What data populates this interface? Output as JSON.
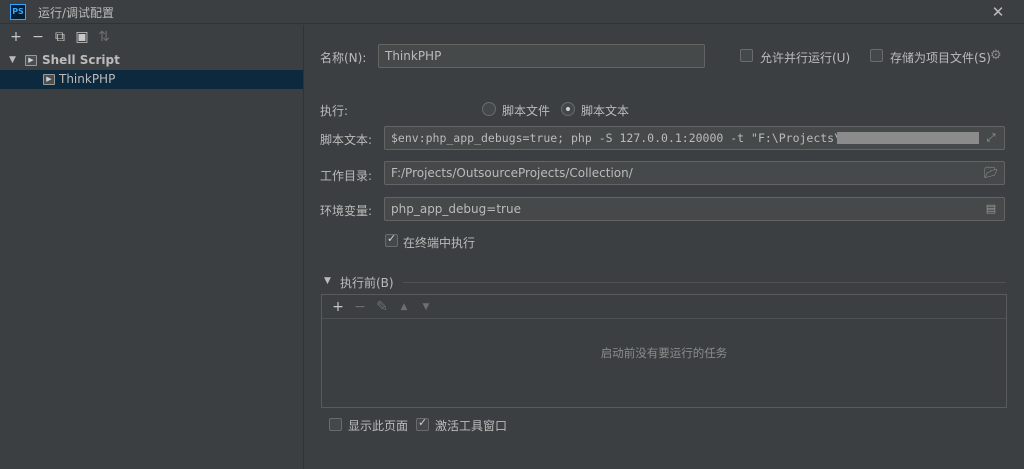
{
  "window": {
    "logo_text": "PS",
    "title": "运行/调试配置",
    "close_icon": "close-icon"
  },
  "left_toolbar": {
    "add": "+",
    "remove": "−",
    "copy": "⧉",
    "folder": "▣",
    "sort": "⇅"
  },
  "tree": {
    "group_label": "Shell Script",
    "group_icon_text": "▶",
    "item_label": "ThinkPHP",
    "item_icon_text": "▶"
  },
  "form": {
    "name_label": "名称(N):",
    "name_value": "ThinkPHP",
    "allow_parallel_label": "允许并行运行(U)",
    "allow_parallel_checked": false,
    "store_as_project_label": "存储为项目文件(S)",
    "store_as_project_checked": false,
    "execute_label": "执行:",
    "script_file_label": "脚本文件",
    "script_text_label": "脚本文本",
    "selected_mode": "script_text",
    "script_text_field_label": "脚本文本:",
    "script_text_value": "$env:php_app_debugs=true; php -S 127.0.0.1:20000 -t \"F:\\Projects\\",
    "workdir_label": "工作目录:",
    "workdir_value": "F:/Projects/OutsourceProjects/Collection/",
    "env_label": "环境变量:",
    "env_value": "php_app_debug=true",
    "run_in_terminal_label": "在终端中执行",
    "run_in_terminal_checked": true
  },
  "before_launch": {
    "section_label": "执行前(B)",
    "toolbar": {
      "add": "+",
      "remove": "−",
      "edit": "✎",
      "up": "▲",
      "down": "▼"
    },
    "empty_text": "启动前没有要运行的任务",
    "show_page_label": "显示此页面",
    "show_page_checked": false,
    "activate_tool_window_label": "激活工具窗口",
    "activate_tool_window_checked": true
  },
  "colors": {
    "background": "#3c3f41",
    "field": "#45494a",
    "selection": "#0d293e",
    "text": "#bbbbbb"
  }
}
